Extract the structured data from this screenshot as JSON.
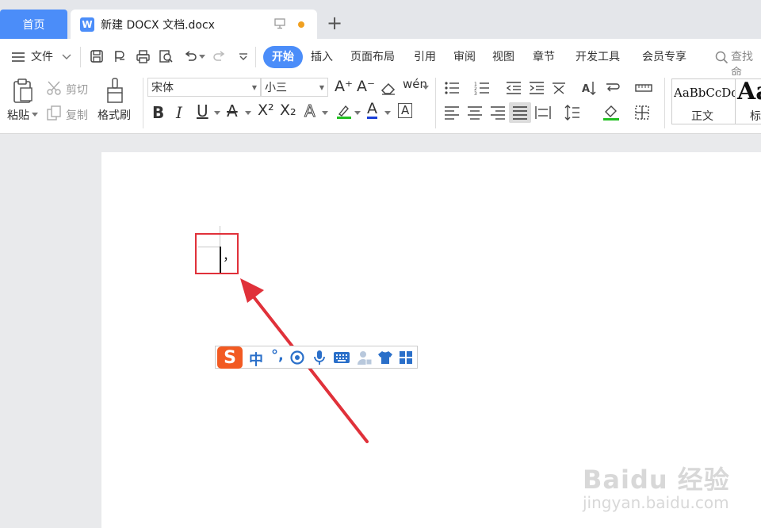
{
  "tabs": {
    "home": "首页",
    "doc_title": "新建 DOCX 文档.docx",
    "doc_icon_letter": "W",
    "new_tab": "+"
  },
  "menu": {
    "file": "文件",
    "items": [
      "开始",
      "插入",
      "页面布局",
      "引用",
      "审阅",
      "视图",
      "章节",
      "开发工具",
      "会员专享"
    ],
    "search": "查找命"
  },
  "ribbon": {
    "paste": "粘贴",
    "cut": "剪切",
    "copy": "复制",
    "format_painter": "格式刷",
    "font_name": "宋体",
    "font_size": "小三",
    "style_normal_preview": "AaBbCcDd",
    "style_normal_label": "正文",
    "style_heading_preview": "Aa",
    "style_heading_label": "标"
  },
  "ime": {
    "logo": "S",
    "lang": "中",
    "punct": "°,"
  },
  "document": {
    "typed_char": "，"
  },
  "watermark": {
    "line1": "Baidu 经验",
    "line2": "jingyan.baidu.com"
  },
  "colors": {
    "accent": "#4b8df9",
    "annotation_red": "#e0313a",
    "ime_orange": "#f25a22",
    "ime_blue": "#2a6fc9"
  }
}
